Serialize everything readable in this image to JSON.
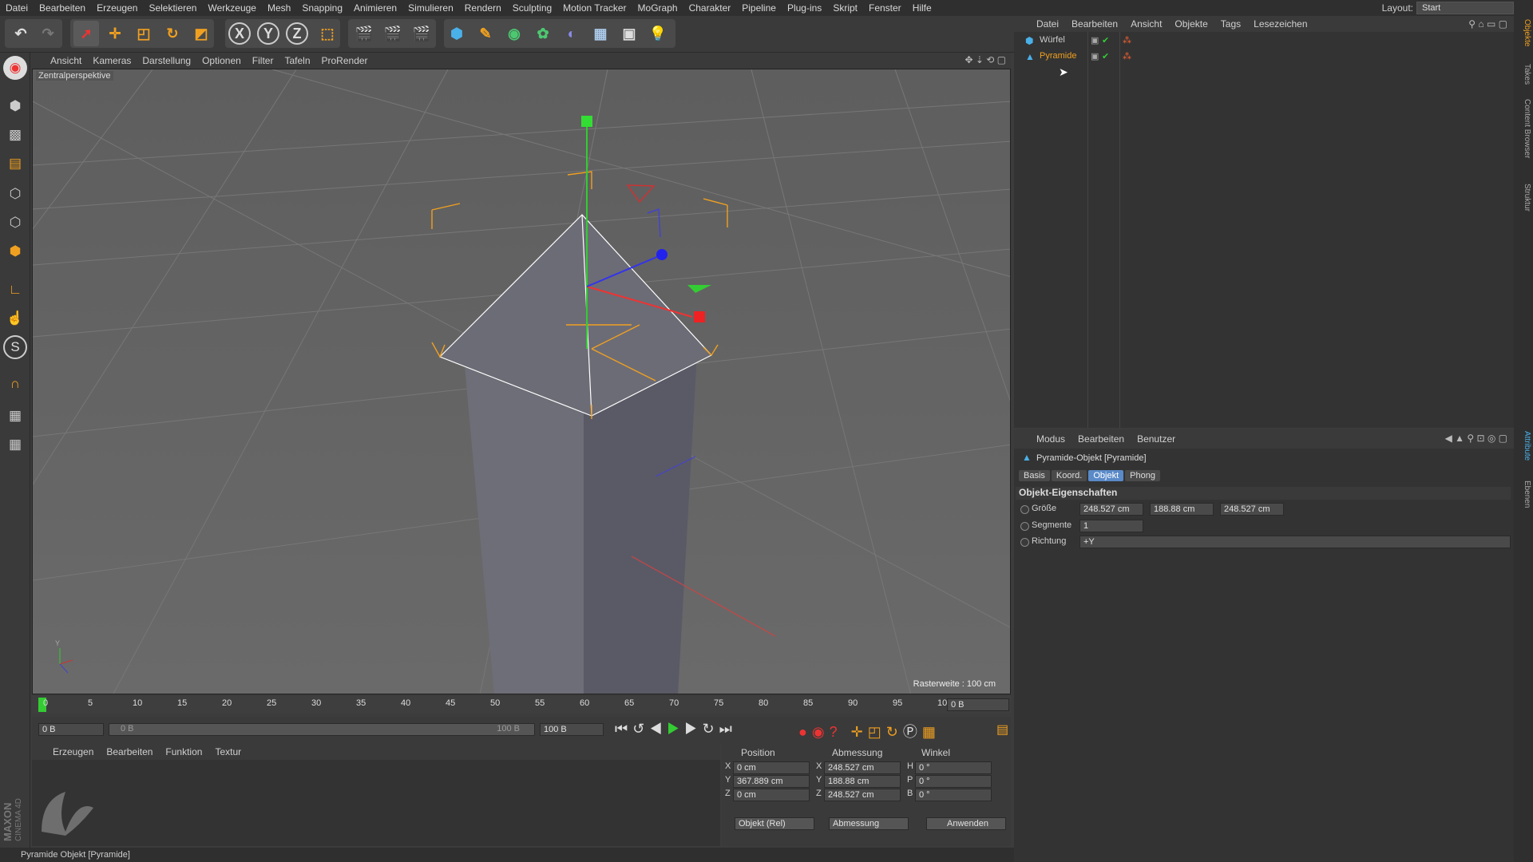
{
  "menu": [
    "Datei",
    "Bearbeiten",
    "Erzeugen",
    "Selektieren",
    "Werkzeuge",
    "Mesh",
    "Snapping",
    "Animieren",
    "Simulieren",
    "Rendern",
    "Sculpting",
    "Motion Tracker",
    "MoGraph",
    "Charakter",
    "Pipeline",
    "Plug-ins",
    "Skript",
    "Fenster",
    "Hilfe"
  ],
  "layout": {
    "label": "Layout:",
    "value": "Start"
  },
  "toolbar": {
    "undo": "undo-icon",
    "select": "cursor-icon",
    "move": "move-icon",
    "scale": "scale-icon",
    "rotate": "rotate-icon",
    "x": "X",
    "y": "Y",
    "z": "Z"
  },
  "viewport": {
    "menu": [
      "Ansicht",
      "Kameras",
      "Darstellung",
      "Optionen",
      "Filter",
      "Tafeln",
      "ProRender"
    ],
    "camera_label": "Zentralperspektive",
    "grid_label": "Rasterweite : 100 cm"
  },
  "timeline": {
    "ticks": [
      "0",
      "5",
      "10",
      "15",
      "20",
      "25",
      "30",
      "35",
      "40",
      "45",
      "50",
      "55",
      "60",
      "65",
      "70",
      "75",
      "80",
      "85",
      "90",
      "95",
      "100"
    ],
    "frame_field": "0 B"
  },
  "transport": {
    "start": "0 B",
    "range_left": "0 B",
    "range_right": "100 B",
    "end": "100 B"
  },
  "material": {
    "menu": [
      "Erzeugen",
      "Bearbeiten",
      "Funktion",
      "Textur"
    ]
  },
  "coords": {
    "headers": [
      "Position",
      "Abmessung",
      "Winkel"
    ],
    "rows": [
      {
        "axis": "X",
        "pos": "0 cm",
        "dimaxis": "X",
        "dim": "248.527 cm",
        "rotaxis": "H",
        "rot": "0 °"
      },
      {
        "axis": "Y",
        "pos": "367.889 cm",
        "dimaxis": "Y",
        "dim": "188.88 cm",
        "rotaxis": "P",
        "rot": "0 °"
      },
      {
        "axis": "Z",
        "pos": "0 cm",
        "dimaxis": "Z",
        "dim": "248.527 cm",
        "rotaxis": "B",
        "rot": "0 °"
      }
    ],
    "mode1": "Objekt (Rel)",
    "mode2": "Abmessung",
    "apply": "Anwenden"
  },
  "status": "Pyramide Objekt [Pyramide]",
  "objects": {
    "menu": [
      "Datei",
      "Bearbeiten",
      "Ansicht",
      "Objekte",
      "Tags",
      "Lesezeichen"
    ],
    "items": [
      {
        "name": "Würfel"
      },
      {
        "name": "Pyramide"
      }
    ]
  },
  "attributes": {
    "menu": [
      "Modus",
      "Bearbeiten",
      "Benutzer"
    ],
    "title": "Pyramide-Objekt [Pyramide]",
    "tabs": [
      "Basis",
      "Koord.",
      "Objekt",
      "Phong"
    ],
    "section": "Objekt-Eigenschaften",
    "size_label": "Größe",
    "size": [
      "248.527 cm",
      "188.88 cm",
      "248.527 cm"
    ],
    "seg_label": "Segmente",
    "seg": "1",
    "dir_label": "Richtung",
    "dir": "+Y"
  },
  "sidetabs": [
    "Objekte",
    "Takes",
    "Content Browser",
    "Struktur",
    "Attribute",
    "Ebenen"
  ],
  "logo": {
    "brand": "MAXON",
    "product": "CINEMA 4D"
  }
}
